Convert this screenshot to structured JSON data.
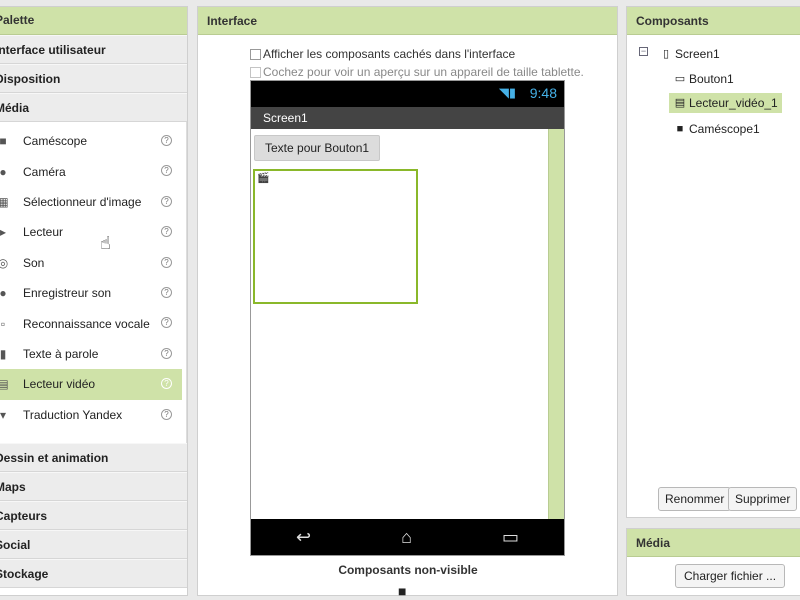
{
  "palette": {
    "header": "Palette",
    "categories_top": [
      "Interface utilisateur",
      "Disposition",
      "Média"
    ],
    "media_items": [
      {
        "label": "Caméscope",
        "icon": "camcorder-icon",
        "glyph": "■"
      },
      {
        "label": "Caméra",
        "icon": "camera-icon",
        "glyph": "●"
      },
      {
        "label": "Sélectionneur d'image",
        "icon": "image-picker-icon",
        "glyph": "▦"
      },
      {
        "label": "Lecteur",
        "icon": "player-icon",
        "glyph": "▸"
      },
      {
        "label": "Son",
        "icon": "sound-icon",
        "glyph": "◎"
      },
      {
        "label": "Enregistreur son",
        "icon": "sound-recorder-icon",
        "glyph": "●"
      },
      {
        "label": "Reconnaissance vocale",
        "icon": "speech-recognizer-icon",
        "glyph": "▫"
      },
      {
        "label": "Texte à parole",
        "icon": "text-to-speech-icon",
        "glyph": "▮"
      },
      {
        "label": "Lecteur vidéo",
        "icon": "video-player-icon",
        "glyph": "▤"
      },
      {
        "label": "Traduction Yandex",
        "icon": "yandex-translate-icon",
        "glyph": "▾"
      }
    ],
    "selected_index": 8,
    "categories_bottom": [
      "Dessin et animation",
      "Maps",
      "Capteurs",
      "Social",
      "Stockage"
    ]
  },
  "viewer": {
    "header": "Interface",
    "show_hidden_label": "Afficher les composants cachés dans l'interface",
    "tablet_preview_label": "Cochez pour voir un aperçu sur un appareil de taille tablette.",
    "status_time": "9:48",
    "screen_title": "Screen1",
    "button_text": "Texte pour Bouton1",
    "nonvisible_label": "Composants non-visible"
  },
  "components": {
    "header": "Composants",
    "tree": [
      {
        "label": "Screen1",
        "icon": "screen-icon"
      },
      {
        "label": "Bouton1",
        "icon": "button-icon"
      },
      {
        "label": "Lecteur_vidéo_1",
        "icon": "video-player-icon",
        "selected": true
      },
      {
        "label": "Caméscope1",
        "icon": "camcorder-icon"
      }
    ],
    "rename_label": "Renommer",
    "delete_label": "Supprimer"
  },
  "media": {
    "header": "Média",
    "upload_label": "Charger fichier ..."
  },
  "colors": {
    "accent_green": "#cfe2a8",
    "selection_border": "#8ab82a",
    "status_blue": "#45b0e6"
  }
}
